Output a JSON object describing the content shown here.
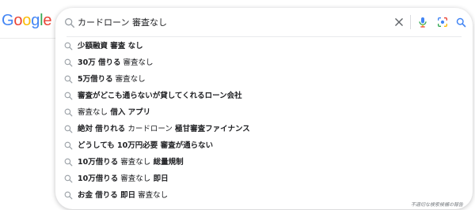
{
  "logo": {
    "letters": [
      "G",
      "o",
      "o",
      "g",
      "l",
      "e"
    ],
    "colors": [
      "#4285F4",
      "#EA4335",
      "#FBBC05",
      "#4285F4",
      "#34A853",
      "#EA4335"
    ]
  },
  "search": {
    "query": "カードローン 審査なし",
    "icons": {
      "leading": "search-icon",
      "clear": "close-icon",
      "voice": "mic-icon",
      "image": "lens-icon",
      "submit": "search-icon"
    }
  },
  "suggestions": [
    [
      {
        "t": "少額融資 審査 なし",
        "b": true
      }
    ],
    [
      {
        "t": "30万 借りる",
        "b": true
      },
      {
        "t": " 審査なし",
        "b": false
      }
    ],
    [
      {
        "t": "5万借りる",
        "b": true
      },
      {
        "t": " 審査なし",
        "b": false
      }
    ],
    [
      {
        "t": "審査がどこも通らないが貸してくれるローン会社",
        "b": true
      }
    ],
    [
      {
        "t": "審査なし",
        "b": false
      },
      {
        "t": " 借入 アプリ",
        "b": true
      }
    ],
    [
      {
        "t": "絶対 借りれる",
        "b": true
      },
      {
        "t": " カードローン",
        "b": false
      },
      {
        "t": " 極甘審査ファイナンス",
        "b": true
      }
    ],
    [
      {
        "t": "どうしても 10万円必要 審査が通らない",
        "b": true
      }
    ],
    [
      {
        "t": "10万借りる",
        "b": true
      },
      {
        "t": " 審査なし",
        "b": false
      },
      {
        "t": " 総量規制",
        "b": true
      }
    ],
    [
      {
        "t": "10万借りる",
        "b": true
      },
      {
        "t": " 審査なし",
        "b": false
      },
      {
        "t": " 即日",
        "b": true
      }
    ],
    [
      {
        "t": "お金 借りる 即日",
        "b": true
      },
      {
        "t": " 審査なし",
        "b": false
      }
    ]
  ],
  "footer": {
    "report_label": "不適切な検索候補の報告"
  },
  "colors": {
    "icon_gray": "#5f6368",
    "mic_blue": "#4285F4",
    "mic_red": "#EA4335",
    "mic_yellow": "#FBBC05",
    "mic_green": "#34A853"
  }
}
